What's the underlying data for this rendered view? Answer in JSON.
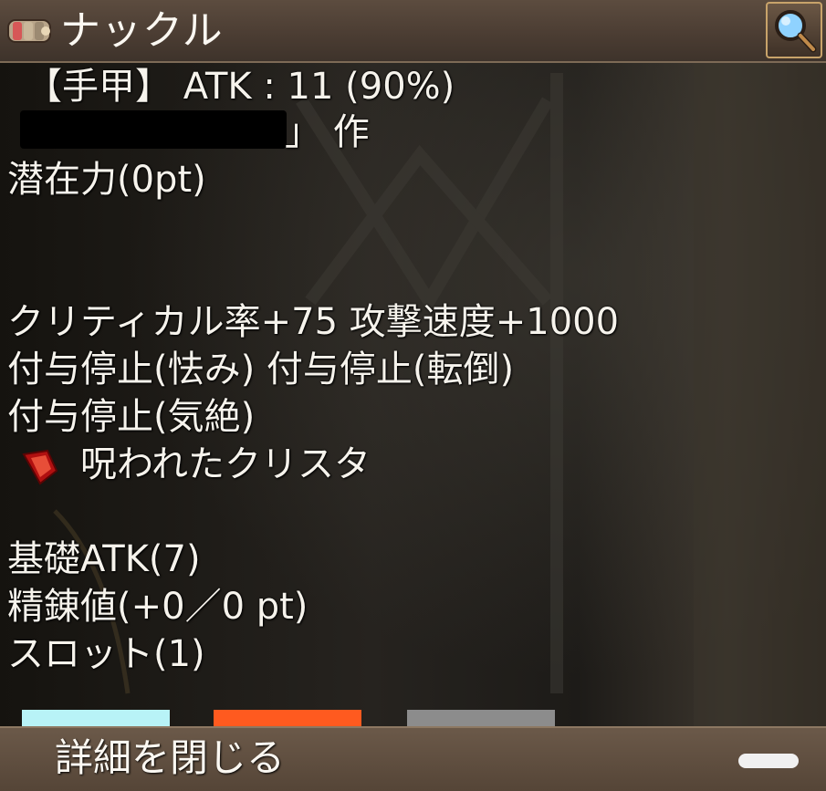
{
  "header": {
    "title": "ナックル",
    "item_icon": "knuckle-icon",
    "search_icon": "magnifier-icon"
  },
  "item": {
    "type_line": "【手甲】 ATK : 11 (90%)",
    "maker_open": "「",
    "maker_close": "」 作",
    "potential": "潜在力(0pt)",
    "stats": [
      "クリティカル率+75 攻撃速度+1000",
      "付与停止(怯み) 付与停止(転倒)",
      "付与停止(気絶)"
    ],
    "crystal_icon": "cursed-crystal-icon",
    "crystal": "呪われたクリスタ",
    "base_atk": "基礎ATK(7)",
    "refine": "精錬値(+0／0 pt)",
    "slot": "スロット(1)"
  },
  "bottom_tabs": {
    "colors": [
      "#b8f3f7",
      "#ff5a1f",
      "#8c8c8c"
    ]
  },
  "footer": {
    "close_label": "詳細を閉じる"
  }
}
